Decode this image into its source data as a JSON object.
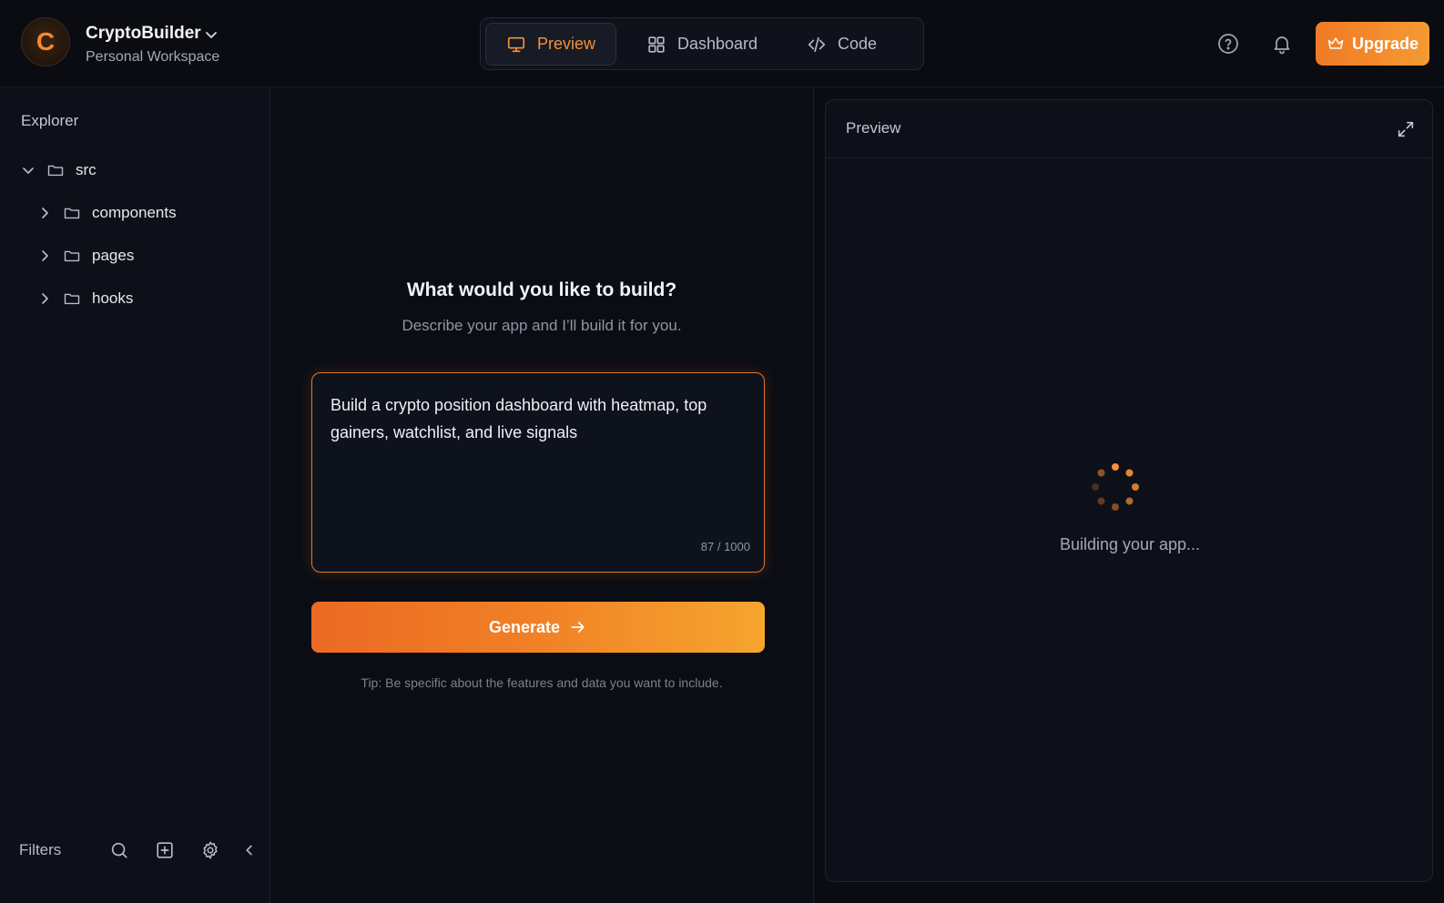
{
  "header": {
    "logo_letter": "C",
    "workspace_name": "CryptoBuilder",
    "workspace_sub": "Personal Workspace",
    "tabs": [
      {
        "label": "Preview",
        "icon": "monitor-icon",
        "active": true
      },
      {
        "label": "Dashboard",
        "icon": "grid-icon",
        "active": false
      },
      {
        "label": "Code",
        "icon": "code-icon",
        "active": false
      }
    ],
    "upgrade_label": "Upgrade"
  },
  "sidebar": {
    "title": "Explorer",
    "tree": [
      {
        "label": "src",
        "expanded": true,
        "depth": 0
      },
      {
        "label": "components",
        "expanded": false,
        "depth": 1
      },
      {
        "label": "pages",
        "expanded": false,
        "depth": 1
      },
      {
        "label": "hooks",
        "expanded": false,
        "depth": 1
      }
    ],
    "footer_label": "Filters"
  },
  "builder": {
    "title": "What would you like to build?",
    "subtitle": "Describe your app and I’ll build it for you.",
    "prompt_value": "Build a crypto position dashboard with heatmap, top gainers, watchlist, and live signals",
    "char_count": "87 / 1000",
    "generate_label": "Generate",
    "tip": "Tip: Be specific about the features and data you want to include."
  },
  "preview": {
    "title": "Preview",
    "status": "Building your app..."
  },
  "colors": {
    "accent": "#f5903a",
    "background": "#0b0d14"
  }
}
